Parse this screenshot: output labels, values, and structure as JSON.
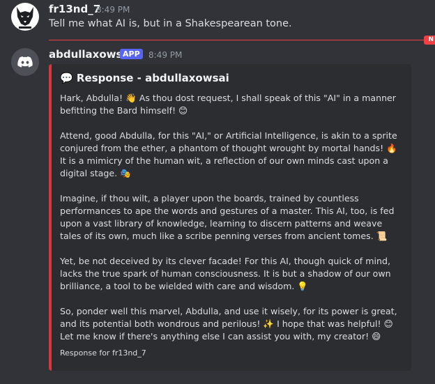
{
  "message1": {
    "username": "fr13nd_7",
    "timestamp": "8:49 PM",
    "text": "Tell me what AI is, but in a Shakespearean tone.",
    "avatar_icon": "wolf-icon"
  },
  "divider": {
    "label": "N"
  },
  "message2": {
    "username": "abdullaxowsai",
    "badge": "APP",
    "timestamp": "8:49 PM",
    "avatar_icon": "discord-icon"
  },
  "embed": {
    "title_icon": "💬",
    "title": "Response - abdullaxowsai",
    "accent_color": "#da373c",
    "paragraphs": [
      "Hark, Abdulla! 👋 As thou dost request, I shall speak of this \"AI\" in a manner befitting the Bard himself! 😊",
      "Attend, good Abdulla, for this \"AI,\" or Artificial Intelligence, is akin to a sprite conjured from the ether, a phantom of thought wrought by mortal hands! 🔥 It is a mimicry of the human wit, a reflection of our own minds cast upon a digital stage. 🎭",
      "Imagine, if thou wilt, a player upon the boards, trained by countless performances to ape the words and gestures of a master. This AI, too, is fed upon a vast library of knowledge, learning to discern patterns and weave tales of its own, much like a scribe penning verses from ancient tomes. 📜",
      "Yet, be not deceived by its clever facade! For this AI, though quick of mind, lacks the true spark of human consciousness. It is but a shadow of our own brilliance, a tool to be wielded with care and wisdom. 💡",
      "So, ponder well this marvel, Abdulla, and use it wisely, for its power is great, and its potential both wondrous and perilous! ✨ I hope that was helpful! 😊 Let me know if there's anything else I can assist you with, my creator! 😄"
    ],
    "footer": "Response for fr13nd_7"
  }
}
